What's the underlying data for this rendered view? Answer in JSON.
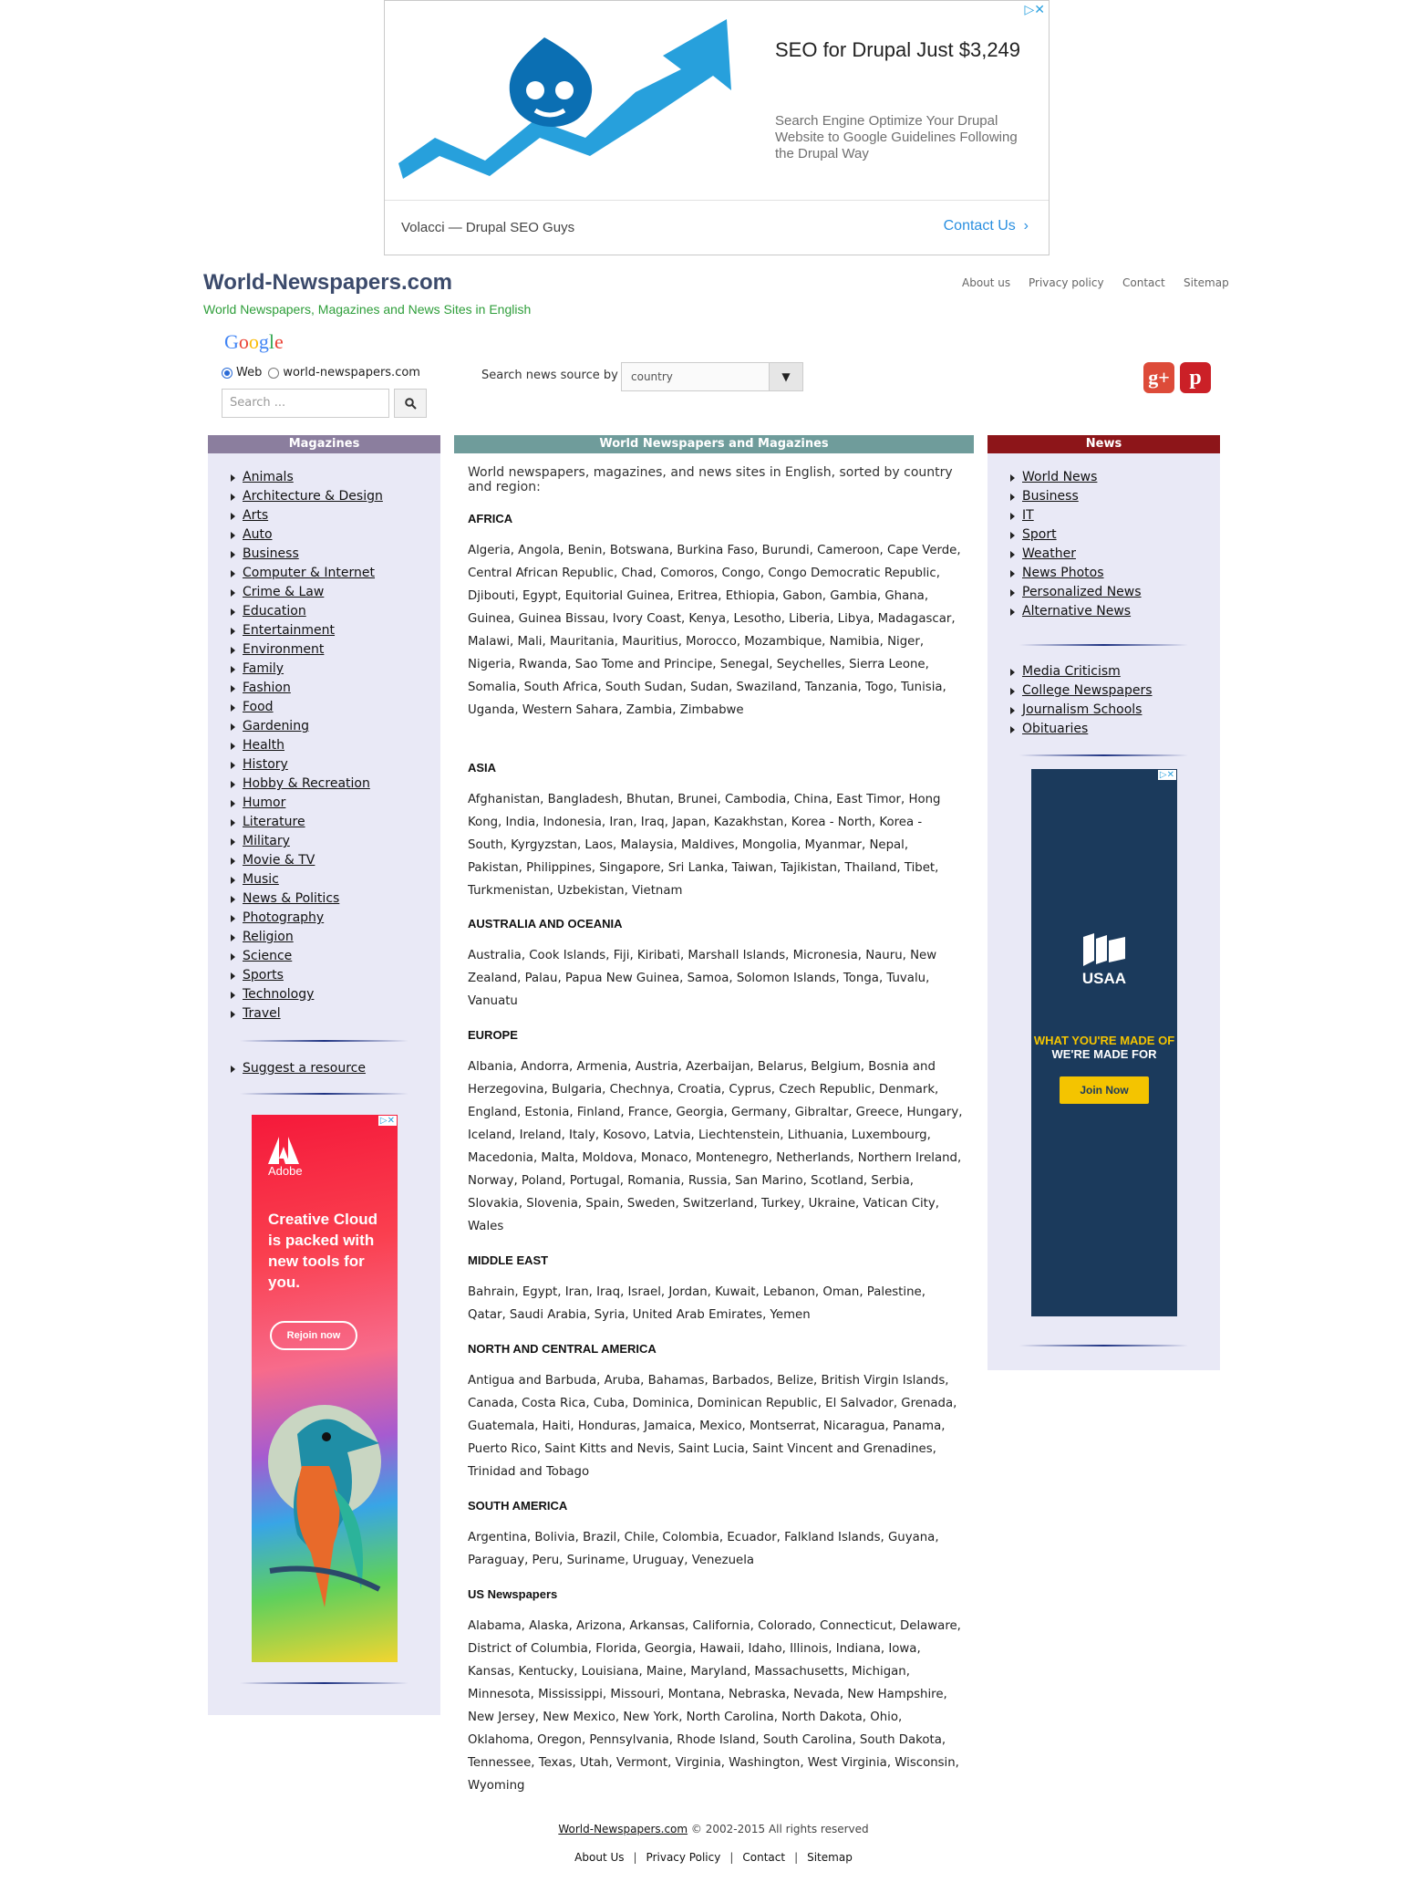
{
  "top_ad": {
    "headline": "SEO for Drupal Just $3,249",
    "description": "Search Engine Optimize Your Drupal Website to Google Guidelines Following the Drupal Way",
    "sponsor": "Volacci — Drupal SEO Guys",
    "cta": "Contact Us",
    "adchoices": "▷✕",
    "accent_color": "#2aa1e0"
  },
  "header": {
    "site_title": "World-Newspapers.com",
    "tagline": "World Newspapers, Magazines and News Sites in English",
    "nav": [
      "About us",
      "Privacy policy",
      "Contact",
      "Sitemap"
    ]
  },
  "search": {
    "google_logo": "Google",
    "scope_web": "Web",
    "scope_site": "world-newspapers.com",
    "placeholder": "Search ...",
    "by_label": "Search news source by",
    "by_value": "country"
  },
  "social": {
    "gplus": "g+",
    "pinterest": "p"
  },
  "magazines": {
    "title": "Magazines",
    "items": [
      "Animals",
      "Architecture & Design",
      "Arts",
      "Auto",
      "Business",
      "Computer & Internet",
      "Crime & Law",
      "Education",
      "Entertainment",
      "Environment",
      "Family",
      "Fashion",
      "Food",
      "Gardening",
      "Health",
      "History",
      "Hobby & Recreation",
      "Humor",
      "Literature",
      "Military",
      "Movie & TV",
      "Music",
      "News & Politics",
      "Photography",
      "Religion",
      "Science",
      "Sports",
      "Technology",
      "Travel"
    ],
    "suggest": "Suggest a resource"
  },
  "adobe_ad": {
    "brand": "Adobe",
    "headline": "Creative Cloud is packed with new tools for you.",
    "cta": "Rejoin now"
  },
  "main": {
    "title": "World Newspapers and Magazines",
    "intro": "World newspapers, magazines, and news sites in English, sorted by country and region:",
    "regions": [
      {
        "name": "AFRICA",
        "countries": "Algeria, Angola, Benin, Botswana, Burkina Faso, Burundi, Cameroon, Cape Verde, Central African Republic, Chad, Comoros, Congo, Congo Democratic Republic, Djibouti, Egypt, Equitorial Guinea, Eritrea, Ethiopia, Gabon, Gambia, Ghana, Guinea, Guinea Bissau, Ivory Coast, Kenya, Lesotho, Liberia, Libya, Madagascar, Malawi, Mali, Mauritania, Mauritius, Morocco, Mozambique, Namibia, Niger, Nigeria, Rwanda, Sao Tome and Principe, Senegal, Seychelles, Sierra Leone, Somalia, South Africa, South Sudan, Sudan, Swaziland, Tanzania, Togo, Tunisia, Uganda, Western Sahara, Zambia, Zimbabwe"
      },
      {
        "name": "ASIA",
        "countries": "Afghanistan, Bangladesh, Bhutan, Brunei, Cambodia, China, East Timor, Hong Kong, India, Indonesia, Iran, Iraq, Japan, Kazakhstan, Korea - North, Korea - South, Kyrgyzstan, Laos, Malaysia, Maldives, Mongolia, Myanmar, Nepal, Pakistan, Philippines, Singapore, Sri Lanka, Taiwan, Tajikistan, Thailand, Tibet, Turkmenistan, Uzbekistan, Vietnam"
      },
      {
        "name": "AUSTRALIA AND OCEANIA",
        "countries": "Australia, Cook Islands, Fiji, Kiribati, Marshall Islands, Micronesia, Nauru, New Zealand, Palau, Papua New Guinea, Samoa, Solomon Islands, Tonga, Tuvalu, Vanuatu"
      },
      {
        "name": "EUROPE",
        "countries": "Albania, Andorra, Armenia, Austria, Azerbaijan, Belarus, Belgium, Bosnia and Herzegovina, Bulgaria, Chechnya, Croatia, Cyprus, Czech Republic, Denmark, England, Estonia, Finland, France, Georgia, Germany, Gibraltar, Greece, Hungary, Iceland, Ireland, Italy, Kosovo, Latvia, Liechtenstein, Lithuania, Luxembourg, Macedonia, Malta, Moldova, Monaco, Montenegro, Netherlands, Northern Ireland, Norway, Poland, Portugal, Romania, Russia, San Marino, Scotland, Serbia, Slovakia, Slovenia, Spain, Sweden, Switzerland, Turkey, Ukraine, Vatican City, Wales"
      },
      {
        "name": "MIDDLE EAST",
        "countries": "Bahrain, Egypt, Iran, Iraq, Israel, Jordan, Kuwait, Lebanon, Oman, Palestine, Qatar, Saudi Arabia, Syria, United Arab Emirates, Yemen"
      },
      {
        "name": "NORTH AND CENTRAL AMERICA",
        "countries": "Antigua and Barbuda, Aruba, Bahamas, Barbados, Belize, British Virgin Islands, Canada, Costa Rica, Cuba, Dominica, Dominican Republic, El Salvador, Grenada, Guatemala, Haiti, Honduras, Jamaica, Mexico, Montserrat, Nicaragua, Panama, Puerto Rico, Saint Kitts and Nevis, Saint Lucia, Saint Vincent and Grenadines, Trinidad and Tobago"
      },
      {
        "name": "SOUTH AMERICA",
        "countries": "Argentina, Bolivia, Brazil, Chile, Colombia, Ecuador, Falkland Islands, Guyana, Paraguay, Peru, Suriname, Uruguay, Venezuela"
      },
      {
        "name": "US Newspapers",
        "countries": "Alabama, Alaska, Arizona, Arkansas, California, Colorado, Connecticut, Delaware, District of Columbia, Florida, Georgia, Hawaii, Idaho, Illinois, Indiana, Iowa, Kansas, Kentucky, Louisiana, Maine, Maryland, Massachusetts, Michigan, Minnesota, Mississippi, Missouri, Montana, Nebraska, Nevada, New Hampshire, New Jersey, New Mexico, New York, North Carolina, North Dakota, Ohio, Oklahoma, Oregon, Pennsylvania, Rhode Island, South Carolina, South Dakota, Tennessee, Texas, Utah, Vermont, Virginia, Washington, West Virginia, Wisconsin, Wyoming"
      }
    ]
  },
  "news": {
    "title": "News",
    "items": [
      "World News",
      "Business",
      "IT",
      "Sport",
      "Weather",
      "News Photos",
      "Personalized News",
      "Alternative News"
    ],
    "items2": [
      "Media Criticism",
      "College Newspapers",
      "Journalism Schools",
      "Obituaries"
    ]
  },
  "usaa_ad": {
    "brand": "USAA",
    "slogan_1": "WHAT YOU'RE MADE OF",
    "slogan_2": "WE'RE MADE FOR",
    "cta": "Join Now"
  },
  "footer": {
    "site_link": "World-Newspapers.com",
    "copyright": "© 2002-2015 All rights reserved",
    "nav": [
      "About Us",
      "Privacy Policy",
      "Contact",
      "Sitemap"
    ]
  },
  "colors": {
    "magazines_header": "#8b7e9e",
    "main_header": "#6f9c9b",
    "news_header": "#8d1519",
    "sidebar_bg": "#e9e9f6",
    "tagline": "#2e9e3a"
  }
}
